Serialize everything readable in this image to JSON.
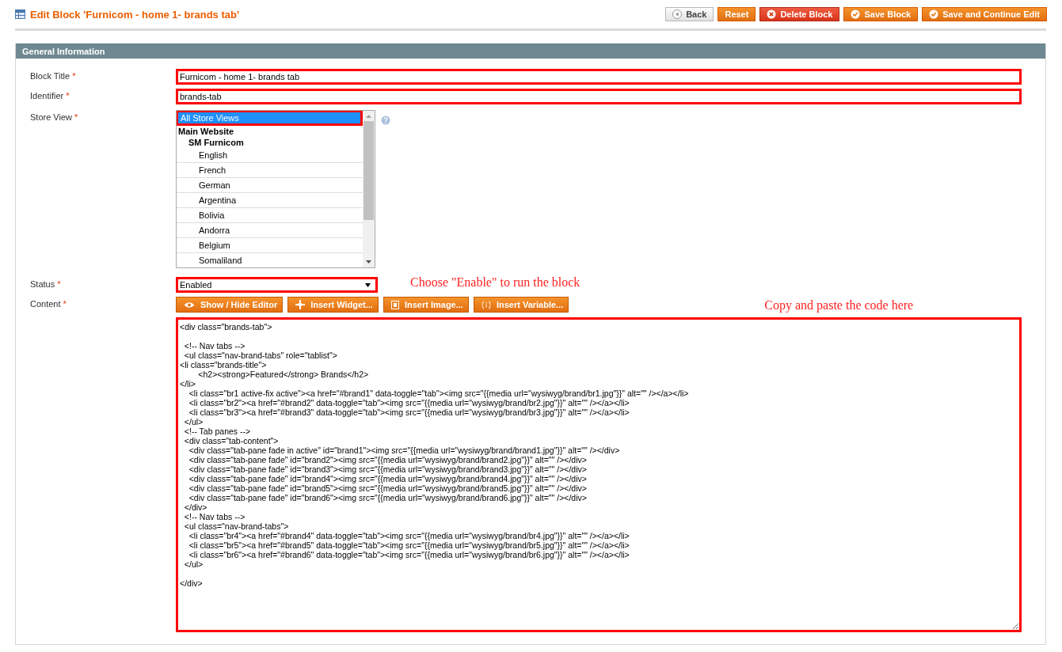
{
  "header": {
    "title": "Edit Block 'Furnicom - home 1- brands tab'"
  },
  "buttons": [
    {
      "label": "Back",
      "kind": "back"
    },
    {
      "label": "Reset",
      "kind": "plain"
    },
    {
      "label": "Delete Block",
      "kind": "delete"
    },
    {
      "label": "Save Block",
      "kind": "save"
    },
    {
      "label": "Save and Continue Edit",
      "kind": "save"
    }
  ],
  "section": {
    "title": "General Information"
  },
  "fields": {
    "block_title": {
      "label": "Block Title",
      "required_mark": "*",
      "value": "Furnicom - home 1- brands tab"
    },
    "identifier": {
      "label": "Identifier",
      "required_mark": "*",
      "value": "brands-tab"
    },
    "store_view": {
      "label": "Store View",
      "required_mark": "*",
      "options": [
        {
          "label": "All Store Views",
          "selected": true
        },
        {
          "label": "Main Website",
          "selected": false,
          "children": [
            {
              "label": "SM Furnicom",
              "selected": false,
              "children": [
                {
                  "label": "English",
                  "selected": false
                },
                {
                  "label": "French",
                  "selected": false
                },
                {
                  "label": "German",
                  "selected": false
                },
                {
                  "label": "Argentina",
                  "selected": false
                },
                {
                  "label": "Bolivia",
                  "selected": false
                },
                {
                  "label": "Andorra",
                  "selected": false
                },
                {
                  "label": "Belgium",
                  "selected": false
                },
                {
                  "label": "Somaliland",
                  "selected": false
                }
              ]
            }
          ]
        }
      ]
    },
    "status": {
      "label": "Status",
      "required_mark": "*",
      "value": "Enabled"
    },
    "content": {
      "label": "Content",
      "required_mark": "*",
      "toolbar": [
        {
          "label": "Show / Hide Editor",
          "kind": "eye"
        },
        {
          "label": "Insert Widget...",
          "kind": "widget"
        },
        {
          "label": "Insert Image...",
          "kind": "image"
        },
        {
          "label": "Insert Variable...",
          "kind": "variable"
        }
      ],
      "value": "<div class=\"brands-tab\">\n\n  <!-- Nav tabs -->\n  <ul class=\"nav-brand-tabs\" role=\"tablist\">\n<li class=\"brands-title\">\n        <h2><strong>Featured</strong> Brands</h2>\n</li>\n    <li class=\"br1 active-fix active\"><a href=\"#brand1\" data-toggle=\"tab\"><img src=\"{{media url=\"wysiwyg/brand/br1.jpg\"}}\" alt=\"\" /></a></li>\n    <li class=\"br2\"><a href=\"#brand2\" data-toggle=\"tab\"><img src=\"{{media url=\"wysiwyg/brand/br2.jpg\"}}\" alt=\"\" /></a></li>\n    <li class=\"br3\"><a href=\"#brand3\" data-toggle=\"tab\"><img src=\"{{media url=\"wysiwyg/brand/br3.jpg\"}}\" alt=\"\" /></a></li>\n  </ul>\n  <!-- Tab panes -->\n  <div class=\"tab-content\">\n    <div class=\"tab-pane fade in active\" id=\"brand1\"><img src=\"{{media url=\"wysiwyg/brand/brand1.jpg\"}}\" alt=\"\" /></div>\n    <div class=\"tab-pane fade\" id=\"brand2\"><img src=\"{{media url=\"wysiwyg/brand/brand2.jpg\"}}\" alt=\"\" /></div>\n    <div class=\"tab-pane fade\" id=\"brand3\"><img src=\"{{media url=\"wysiwyg/brand/brand3.jpg\"}}\" alt=\"\" /></div>\n    <div class=\"tab-pane fade\" id=\"brand4\"><img src=\"{{media url=\"wysiwyg/brand/brand4.jpg\"}}\" alt=\"\" /></div>\n    <div class=\"tab-pane fade\" id=\"brand5\"><img src=\"{{media url=\"wysiwyg/brand/brand5.jpg\"}}\" alt=\"\" /></div>\n    <div class=\"tab-pane fade\" id=\"brand6\"><img src=\"{{media url=\"wysiwyg/brand/brand6.jpg\"}}\" alt=\"\" /></div>\n  </div>\n  <!-- Nav tabs -->\n  <ul class=\"nav-brand-tabs\">\n    <li class=\"br4\"><a href=\"#brand4\" data-toggle=\"tab\"><img src=\"{{media url=\"wysiwyg/brand/br4.jpg\"}}\" alt=\"\" /></a></li>\n    <li class=\"br5\"><a href=\"#brand5\" data-toggle=\"tab\"><img src=\"{{media url=\"wysiwyg/brand/br5.jpg\"}}\" alt=\"\" /></a></li>\n    <li class=\"br6\"><a href=\"#brand6\" data-toggle=\"tab\"><img src=\"{{media url=\"wysiwyg/brand/br6.jpg\"}}\" alt=\"\" /></a></li>\n  </ul>\n\n</div>"
    }
  },
  "annotations": {
    "status_note": "Choose \"Enable\" to run the block",
    "content_note": "Copy and paste the code here"
  }
}
